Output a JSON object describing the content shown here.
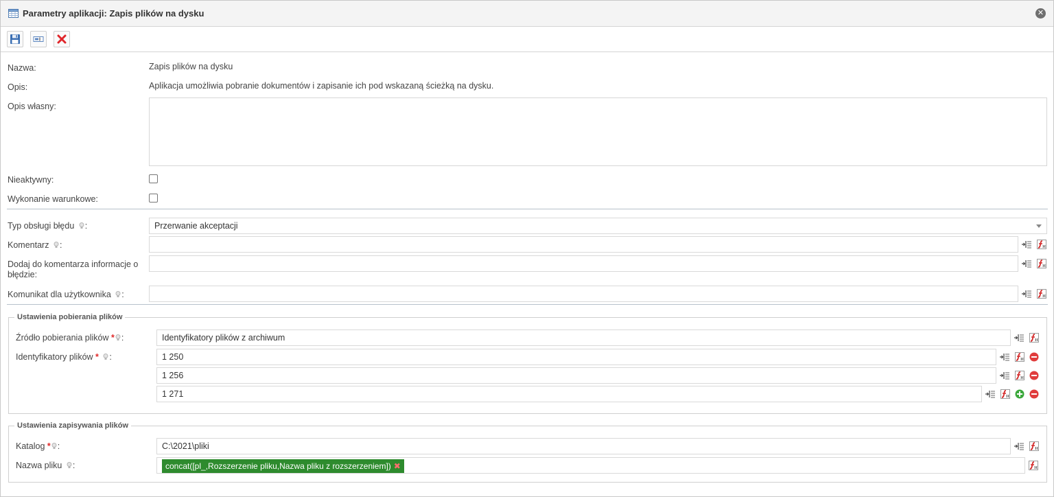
{
  "window": {
    "title": "Parametry aplikacji: Zapis plików na dysku",
    "close_label": "✕"
  },
  "icons": {
    "title": "table-icon",
    "save": "floppy-disk-icon",
    "settings": "text-field-icon",
    "delete": "red-x-icon",
    "hint": "lightbulb-icon",
    "insert_variable": "insert-variable-icon",
    "function": "function-editor-icon",
    "remove": "remove-circle-icon",
    "add": "add-circle-icon"
  },
  "colors": {
    "required": "#e02a2a",
    "tag_bg": "#2e8b2e",
    "remove": "#e03c3c",
    "add": "#3ca83c"
  },
  "form": {
    "name_label": "Nazwa:",
    "name_value": "Zapis plików na dysku",
    "desc_label": "Opis:",
    "desc_value": "Aplikacja umożliwia pobranie dokumentów i zapisanie ich pod wskazaną ścieżką na dysku.",
    "own_desc_label": "Opis własny:",
    "own_desc_value": "",
    "inactive_label": "Nieaktywny:",
    "conditional_label": "Wykonanie warunkowe:"
  },
  "errors": {
    "type_label": "Typ obsługi błędu",
    "type_value": "Przerwanie akceptacji",
    "comment_label": "Komentarz",
    "comment_value": "",
    "add_info_label_1": "Dodaj do komentarza informacje o",
    "add_info_label_2": "błędzie:",
    "add_info_value": "",
    "user_msg_label": "Komunikat dla użytkownika",
    "user_msg_value": ""
  },
  "download": {
    "legend": "Ustawienia pobierania plików",
    "source_label": "Źródło pobierania plików",
    "source_value": "Identyfikatory plików z archiwum",
    "ids_label": "Identyfikatory plików",
    "ids": [
      "1 250",
      "1 256",
      "1 271"
    ]
  },
  "save": {
    "legend": "Ustawienia zapisywania plików",
    "dir_label": "Katalog",
    "dir_value": "C:\\2021\\pliki",
    "filename_label": "Nazwa pliku",
    "filename_tag": "concat([pl_,Rozszerzenie pliku,Nazwa pliku z rozszerzeniem])",
    "tag_remove": "✖"
  },
  "common": {
    "required_mark": "*",
    "colon": ":"
  }
}
